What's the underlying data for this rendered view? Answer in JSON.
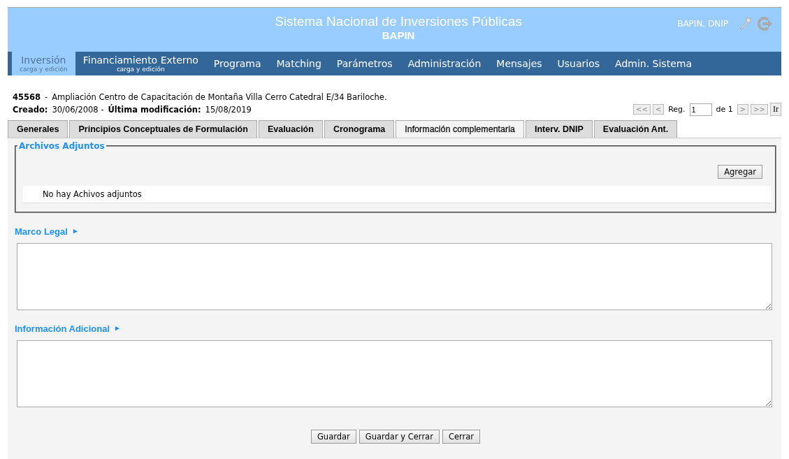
{
  "header": {
    "title": "Sistema Nacional de Inversiones Públicas",
    "subtitle": "BAPIN",
    "user": "BAPIN, DNIP"
  },
  "nav": [
    {
      "label": "Inversión",
      "sub": "carga y edición",
      "selected": true
    },
    {
      "label": "Financiamiento Externo",
      "sub": "carga y edición",
      "selected": false
    },
    {
      "label": "Programa",
      "selected": false
    },
    {
      "label": "Matching",
      "selected": false
    },
    {
      "label": "Parámetros",
      "selected": false
    },
    {
      "label": "Administración",
      "selected": false
    },
    {
      "label": "Mensajes",
      "selected": false
    },
    {
      "label": "Usuarios",
      "selected": false
    },
    {
      "label": "Admin. Sistema",
      "selected": false
    }
  ],
  "record": {
    "id": "45568",
    "separator": "-",
    "name": "Ampliación Centro de Capacitación de Montaña Villa Cerro Catedral E/34 Bariloche.",
    "created_label": "Creado:",
    "created": "30/06/2008 -",
    "modified_label": "Última modificación:",
    "modified": "15/08/2019"
  },
  "pager": {
    "first": "<<",
    "prev": "<",
    "reg_label": "Reg.",
    "reg_value": "1",
    "of": "de 1",
    "next": ">",
    "last": ">>",
    "go": "Ir"
  },
  "tabs": [
    {
      "label": "Generales",
      "selected": false
    },
    {
      "label": "Principios Conceptuales de Formulación",
      "selected": false
    },
    {
      "label": "Evaluación",
      "selected": false
    },
    {
      "label": "Cronograma",
      "selected": false
    },
    {
      "label": "Información complementaria",
      "selected": true
    },
    {
      "label": "Interv. DNIP",
      "selected": false
    },
    {
      "label": "Evaluación Ant.",
      "selected": false
    }
  ],
  "attachments": {
    "legend": "Archivos Adjuntos",
    "add_button": "Agregar",
    "empty": "No hay Achivos adjuntos"
  },
  "sections": [
    {
      "label": "Marco Legal",
      "arrow": "▸"
    },
    {
      "label": "Información Adicional",
      "arrow": "▸"
    }
  ],
  "buttons": [
    "Guardar",
    "Guardar y Cerrar",
    "Cerrar"
  ]
}
